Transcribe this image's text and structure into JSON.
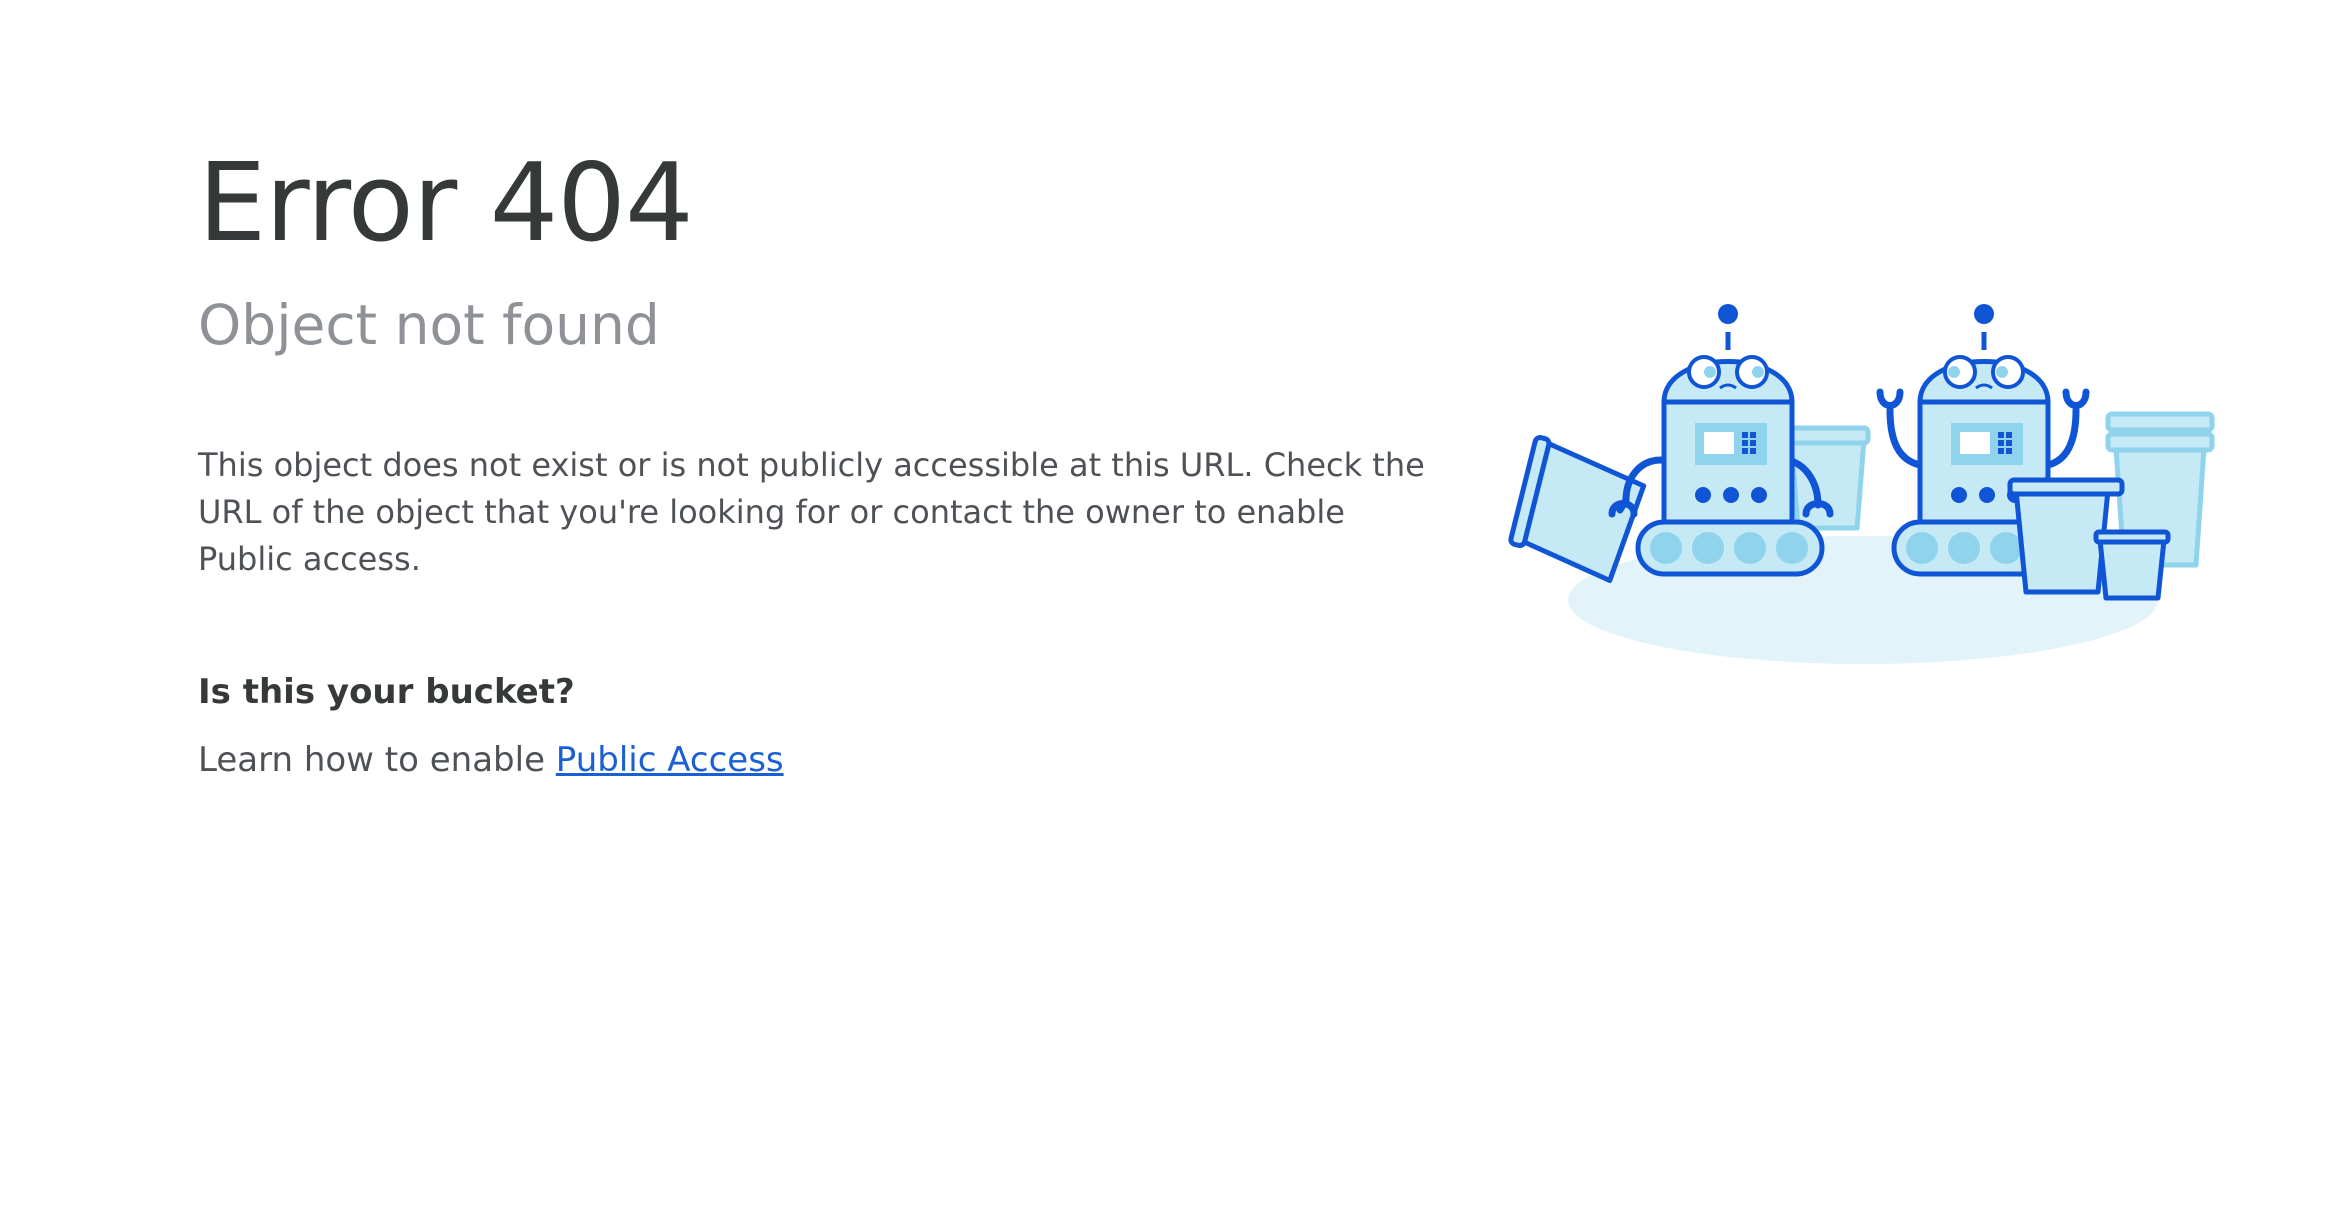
{
  "error": {
    "title": "Error 404",
    "subtitle": "Object not found",
    "description": "This object does not exist or is not publicly accessible at this URL. Check the URL of the object that you're looking for or contact the owner to enable Public access."
  },
  "bucket": {
    "heading": "Is this your bucket?",
    "learn_prefix": "Learn how to enable ",
    "learn_link": "Public Access"
  },
  "illustration": {
    "name": "two-robots-with-buckets-illustration",
    "colors": {
      "outline": "#0f55d6",
      "fill": "#c5e9f5",
      "light": "#e2f4fa",
      "accent": "#8fd3ec"
    }
  }
}
